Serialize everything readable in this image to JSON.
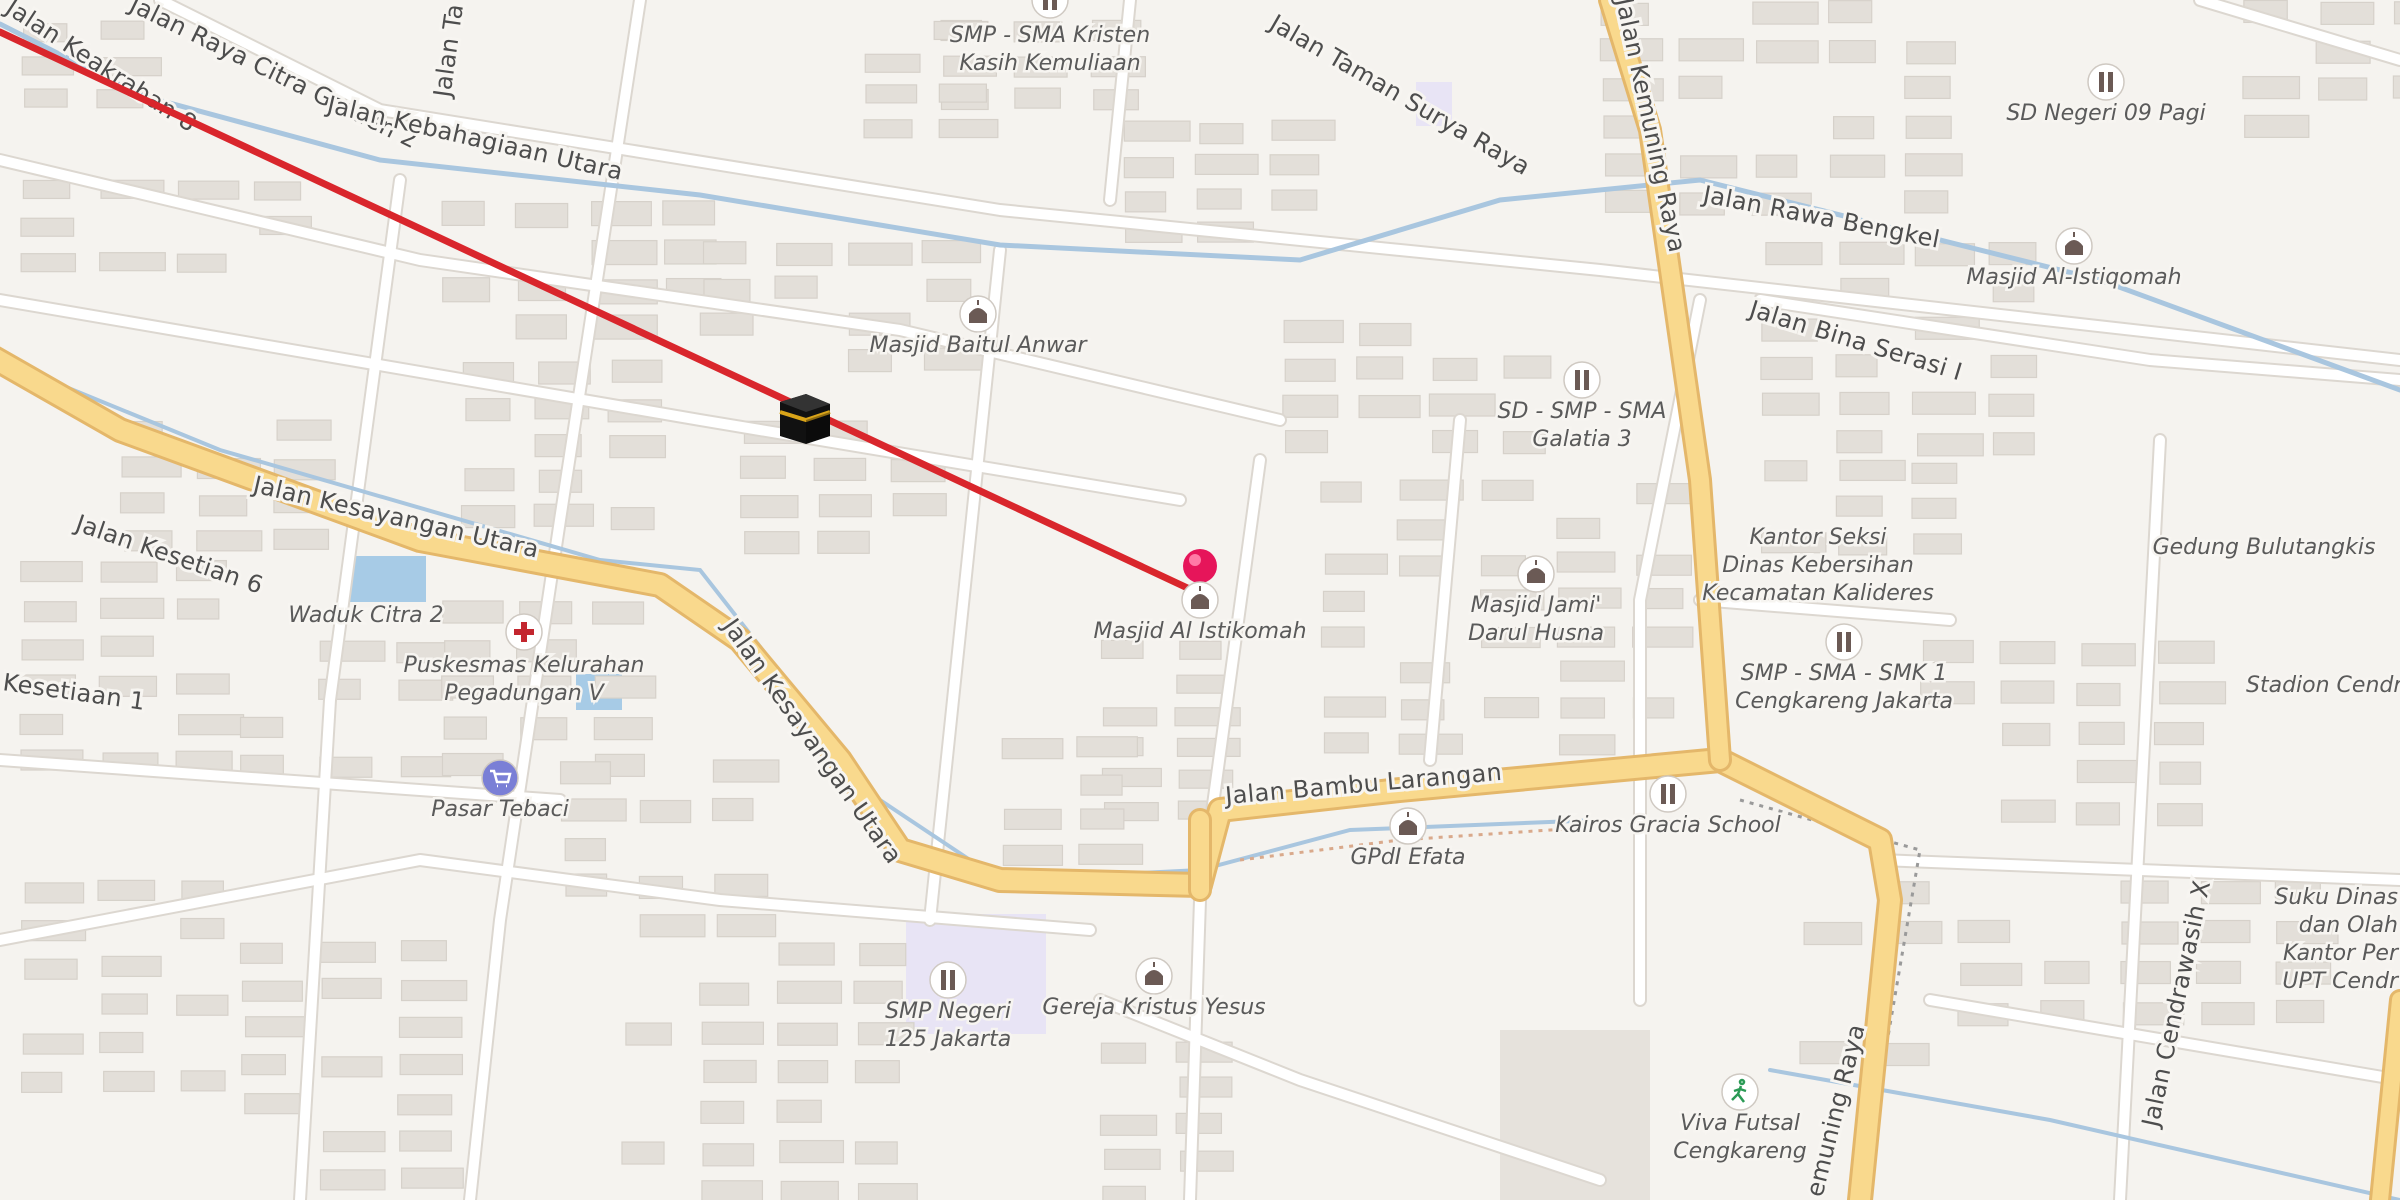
{
  "colors": {
    "background": "#f5f3ef",
    "major_road": "#f9d98d",
    "major_road_casing": "#e4b76a",
    "water": "#a9c6df",
    "route_line": "#d9262c",
    "marker": "#e6155a"
  },
  "roads": [
    {
      "name": "Jalan Keakraban 8"
    },
    {
      "name": "Jalan Raya Citra Garden 2"
    },
    {
      "name": "Jalan Ta"
    },
    {
      "name": "Jalan Kebahagiaan Utara"
    },
    {
      "name": "Jalan Taman Surya Raya"
    },
    {
      "name": "Jalan Kemuning Raya"
    },
    {
      "name": "Jalan Rawa Bengkel"
    },
    {
      "name": "Jalan Bina Serasi I"
    },
    {
      "name": "Jalan Kesayangan Utara"
    },
    {
      "name": "Jalan Kesetian 6"
    },
    {
      "name": "Kesetiaan 1"
    },
    {
      "name": "Jalan Kesayangan Utara"
    },
    {
      "name": "Jalan Bambu Larangan"
    },
    {
      "name": "emuning Raya"
    },
    {
      "name": "Jalan Cendrawasih X"
    }
  ],
  "pois": [
    {
      "name": "SMP - SMA Kristen\nKasih Kemuliaan",
      "icon": "school-icon"
    },
    {
      "name": "SD Negeri 09 Pagi",
      "icon": "school-icon"
    },
    {
      "name": "Masjid Al-Istiqomah",
      "icon": "mosque-icon"
    },
    {
      "name": "Masjid Baitul Anwar",
      "icon": "mosque-icon"
    },
    {
      "name": "SD - SMP - SMA\nGalatia 3",
      "icon": "school-icon"
    },
    {
      "name": "Kantor Seksi\nDinas Kebersihan\nKecamatan Kalideres",
      "icon": "none"
    },
    {
      "name": "Gedung Bulutangkis",
      "icon": "none"
    },
    {
      "name": "Masjid Al Istikomah",
      "icon": "mosque-icon"
    },
    {
      "name": "Masjid Jami'\nDarul Husna",
      "icon": "mosque-icon"
    },
    {
      "name": "SMP - SMA - SMK 1\nCengkareng Jakarta",
      "icon": "school-icon"
    },
    {
      "name": "Stadion Cendra",
      "icon": "none"
    },
    {
      "name": "Waduk Citra 2",
      "icon": "none"
    },
    {
      "name": "Puskesmas Kelurahan\nPegadungan V",
      "icon": "clinic-icon"
    },
    {
      "name": "Pasar Tebaci",
      "icon": "market-icon"
    },
    {
      "name": "GPdI Efata",
      "icon": "church-icon"
    },
    {
      "name": "Kairos Gracia School",
      "icon": "school-icon"
    },
    {
      "name": "SMP Negeri\n125 Jakarta",
      "icon": "school-icon"
    },
    {
      "name": "Gereja Kristus Yesus",
      "icon": "church-icon"
    },
    {
      "name": "Viva Futsal\nCengkareng",
      "icon": "sports-icon"
    },
    {
      "name": "Suku Dinas\ndan Olah\nKantor Per\nUPT Cendr",
      "icon": "none"
    }
  ],
  "route": {
    "description": "Qibla direction line",
    "icon": "kaaba-icon"
  },
  "marker": {
    "icon": "location-pin-icon"
  }
}
